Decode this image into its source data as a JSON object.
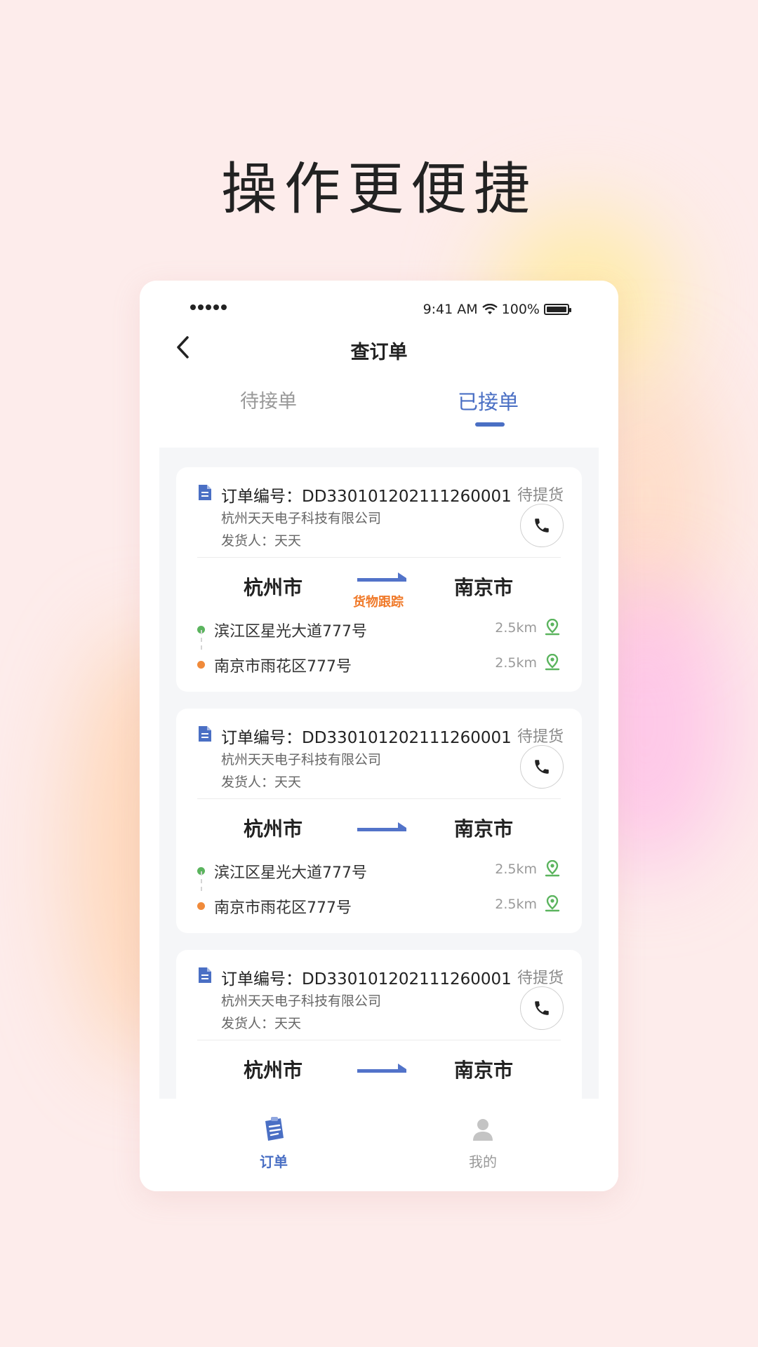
{
  "headline": "操作更便捷",
  "status_bar": {
    "time": "9:41 AM",
    "battery": "100%"
  },
  "nav": {
    "title": "查订单"
  },
  "tabs": {
    "pending": "待接单",
    "accepted": "已接单"
  },
  "orders": [
    {
      "order_label": "订单编号：",
      "order_no": "DD330101202111260001",
      "status": "待提货",
      "company": "杭州天天电子科技有限公司",
      "shipper": "发货人：天天",
      "from_city": "杭州市",
      "to_city": "南京市",
      "tracking_label": "货物跟踪",
      "pickup_address": "滨江区星光大道777号",
      "pickup_distance": "2.5km",
      "delivery_address": "南京市雨花区777号",
      "delivery_distance": "2.5km"
    },
    {
      "order_label": "订单编号：",
      "order_no": "DD330101202111260001",
      "status": "待提货",
      "company": "杭州天天电子科技有限公司",
      "shipper": "发货人：天天",
      "from_city": "杭州市",
      "to_city": "南京市",
      "pickup_address": "滨江区星光大道777号",
      "pickup_distance": "2.5km",
      "delivery_address": "南京市雨花区777号",
      "delivery_distance": "2.5km"
    },
    {
      "order_label": "订单编号：",
      "order_no": "DD330101202111260001",
      "status": "待提货",
      "company": "杭州天天电子科技有限公司",
      "shipper": "发货人：天天",
      "from_city": "杭州市",
      "to_city": "南京市"
    }
  ],
  "tabbar": {
    "orders": "订单",
    "mine": "我的"
  },
  "colors": {
    "accent": "#4a6fc4",
    "tracking": "#f07a2a",
    "pickup_dot": "#5bb45e",
    "delivery_dot": "#f08a3a",
    "pin": "#5bb45e"
  },
  "icons": {
    "back": "chevron-left-icon",
    "order_doc": "document-icon",
    "phone": "phone-icon",
    "location": "location-pin-icon",
    "tab_orders": "clipboard-icon",
    "tab_mine": "user-icon"
  }
}
